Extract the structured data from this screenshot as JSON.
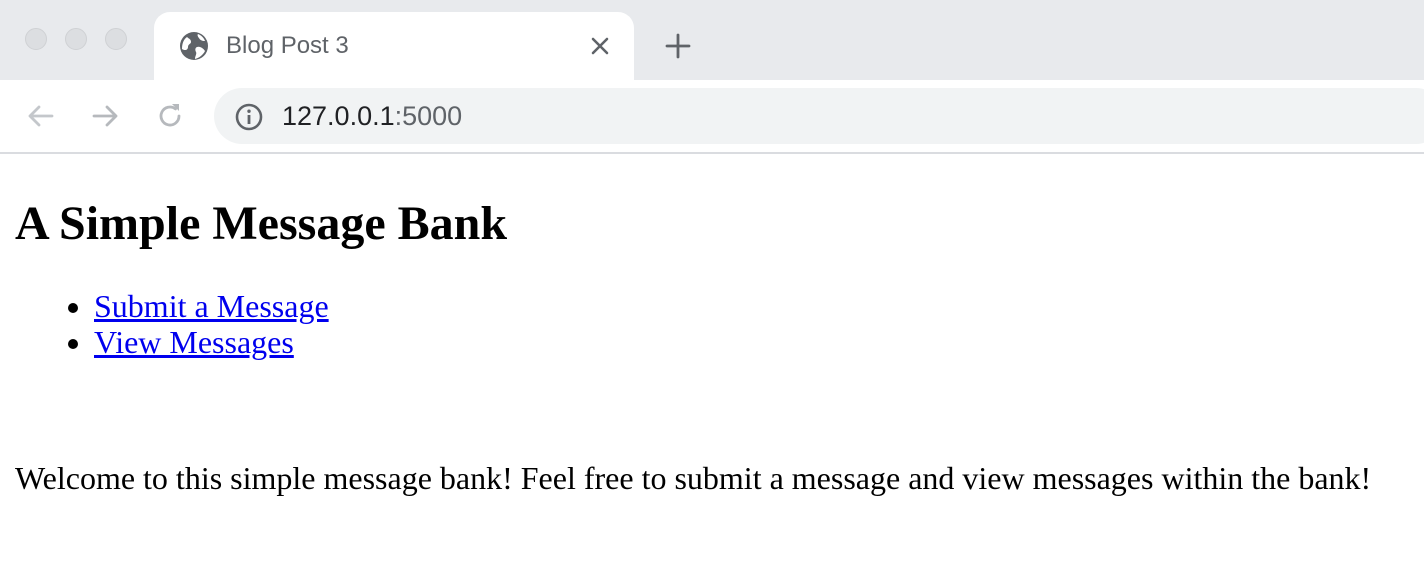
{
  "browser": {
    "tab": {
      "title": "Blog Post 3",
      "icon": "globe-icon",
      "close_icon": "close-icon"
    },
    "new_tab_icon": "plus-icon",
    "toolbar": {
      "back_icon": "arrow-left-icon",
      "forward_icon": "arrow-right-icon",
      "reload_icon": "reload-icon",
      "site_info_icon": "info-icon"
    },
    "address_bar": {
      "host": "127.0.0.1",
      "port": ":5000"
    },
    "colors": {
      "chrome_background": "#e8eaed",
      "omnibox_background": "#f1f3f4",
      "icon_gray": "#5f6368"
    }
  },
  "page": {
    "title": "A Simple Message Bank",
    "nav_links": [
      {
        "label": "Submit a Message"
      },
      {
        "label": "View Messages"
      }
    ],
    "welcome_text": "Welcome to this simple message bank! Feel free to submit a message and view messages within the bank!",
    "colors": {
      "link": "#0000ee",
      "text": "#000000"
    }
  }
}
